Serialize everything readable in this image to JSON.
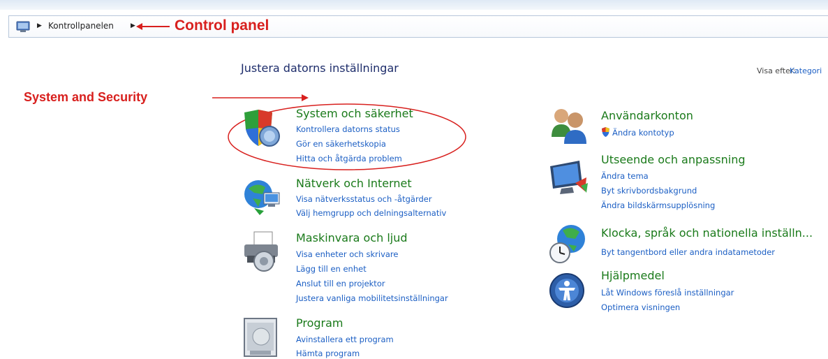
{
  "address_bar": {
    "path": "Kontrollpanelen"
  },
  "annotations": {
    "control_panel": "Control panel",
    "system_security": "System and Security"
  },
  "header": {
    "title": "Justera datorns inställningar",
    "view_by_label": "Visa efter:",
    "view_by_value": "Kategori"
  },
  "categories": [
    {
      "title": "System och säkerhet",
      "icon": "shield-icon",
      "links": [
        "Kontrollera datorns status",
        "Gör en säkerhetskopia",
        "Hitta och åtgärda problem"
      ]
    },
    {
      "title": "Nätverk och Internet",
      "icon": "network-globe-icon",
      "links": [
        "Visa nätverksstatus och -åtgärder",
        "Välj hemgrupp och delningsalternativ"
      ]
    },
    {
      "title": "Maskinvara och ljud",
      "icon": "printer-icon",
      "links": [
        "Visa enheter och skrivare",
        "Lägg till en enhet",
        "Anslut till en projektor",
        "Justera vanliga mobilitetsinställningar"
      ]
    },
    {
      "title": "Program",
      "icon": "programs-icon",
      "links": [
        "Avinstallera ett program",
        "Hämta program"
      ]
    },
    {
      "title": "Användarkonton",
      "icon": "users-icon",
      "links": [
        "Ändra kontotyp"
      ]
    },
    {
      "title": "Utseende och anpassning",
      "icon": "display-icon",
      "links": [
        "Ändra tema",
        "Byt skrivbordsbakgrund",
        "Ändra bildskärmsupplösning"
      ]
    },
    {
      "title": "Klocka, språk och nationella inställn...",
      "icon": "clock-globe-icon",
      "links": [
        "Byt tangentbord eller andra indatametoder"
      ]
    },
    {
      "title": "Hjälpmedel",
      "icon": "accessibility-icon",
      "links": [
        "Låt Windows föreslå inställningar",
        "Optimera visningen"
      ]
    }
  ],
  "colors": {
    "category_title": "#1a7a1a",
    "link": "#1c5fc4",
    "annotation": "#d8201e"
  }
}
